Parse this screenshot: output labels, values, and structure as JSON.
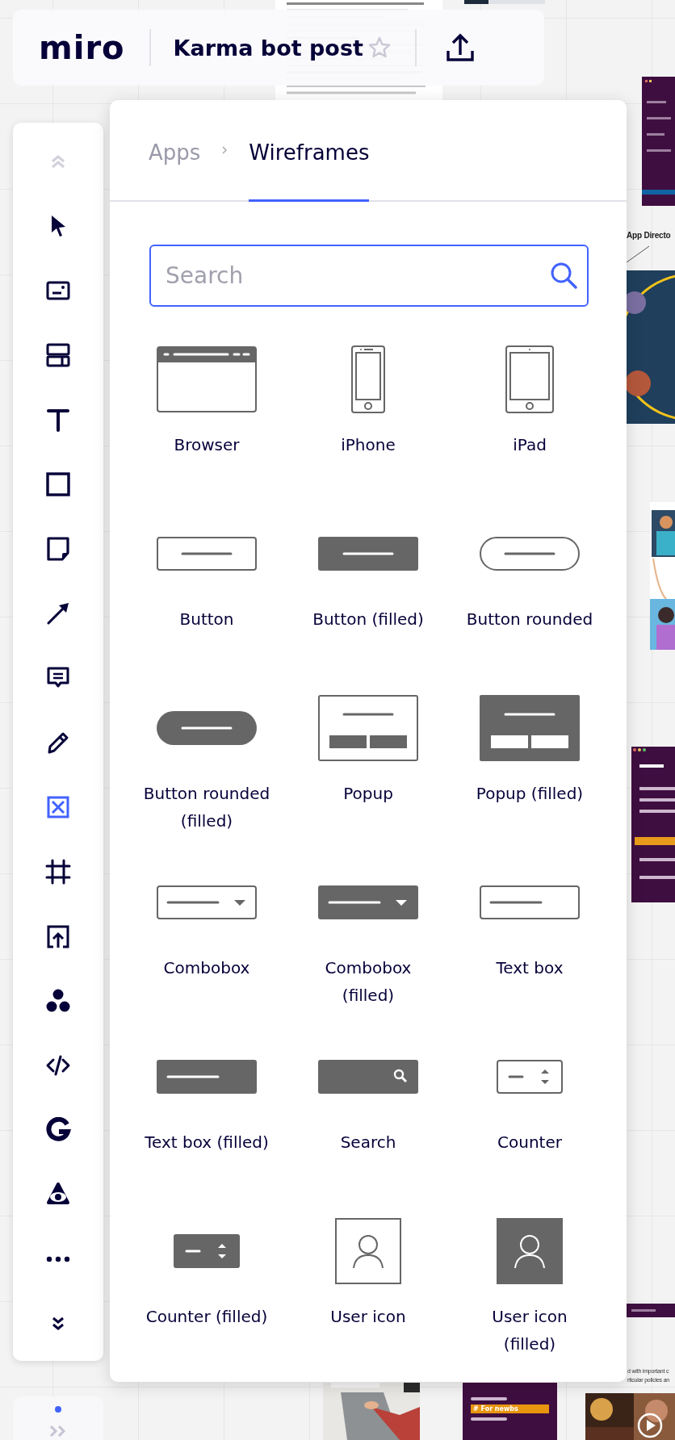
{
  "board": {
    "labels": [
      {
        "kind": "heading",
        "text": "App Directo"
      },
      {
        "kind": "note",
        "text": "d with important c"
      },
      {
        "kind": "note",
        "text": "rticular policies an"
      },
      {
        "kind": "channel",
        "text": "# For newbs"
      }
    ]
  },
  "top_bar": {
    "logo": "miro",
    "board_title": "Karma bot post",
    "starred": false
  },
  "toolbar": {
    "tools": [
      {
        "kind": "collapse-up",
        "selected": false,
        "disabled": true
      },
      {
        "kind": "select",
        "selected": false,
        "disabled": false
      },
      {
        "kind": "card",
        "selected": false,
        "disabled": false
      },
      {
        "kind": "templates",
        "selected": false,
        "disabled": false
      },
      {
        "kind": "text",
        "selected": false,
        "disabled": false
      },
      {
        "kind": "shape",
        "selected": false,
        "disabled": false
      },
      {
        "kind": "sticky",
        "selected": false,
        "disabled": false
      },
      {
        "kind": "arrow",
        "selected": false,
        "disabled": false
      },
      {
        "kind": "comment",
        "selected": false,
        "disabled": false
      },
      {
        "kind": "pen",
        "selected": false,
        "disabled": false
      },
      {
        "kind": "wireframe",
        "selected": true,
        "disabled": false
      },
      {
        "kind": "frame",
        "selected": false,
        "disabled": false
      },
      {
        "kind": "upload",
        "selected": false,
        "disabled": false
      },
      {
        "kind": "circles",
        "selected": false,
        "disabled": false
      },
      {
        "kind": "embed",
        "selected": false,
        "disabled": false
      },
      {
        "kind": "google",
        "selected": false,
        "disabled": false
      },
      {
        "kind": "eye",
        "selected": false,
        "disabled": false
      },
      {
        "kind": "more",
        "selected": false,
        "disabled": false
      },
      {
        "kind": "collapse-down",
        "selected": false,
        "disabled": false
      }
    ]
  },
  "panel": {
    "breadcrumb": [
      {
        "label": "Apps",
        "selected": false
      },
      {
        "label": "Wireframes",
        "selected": true
      }
    ],
    "search": {
      "placeholder": "Search"
    },
    "items": [
      {
        "kind": "browser",
        "label": "Browser"
      },
      {
        "kind": "iphone",
        "label": "iPhone"
      },
      {
        "kind": "ipad",
        "label": "iPad"
      },
      {
        "kind": "button",
        "label": "Button"
      },
      {
        "kind": "button-filled",
        "label": "Button (filled)"
      },
      {
        "kind": "button-rounded",
        "label": "Button rounded"
      },
      {
        "kind": "button-rounded-filled",
        "label": "Button rounded (filled)"
      },
      {
        "kind": "popup",
        "label": "Popup"
      },
      {
        "kind": "popup-filled",
        "label": "Popup (filled)"
      },
      {
        "kind": "combobox",
        "label": "Combobox"
      },
      {
        "kind": "combobox-filled",
        "label": "Combobox (filled)"
      },
      {
        "kind": "textbox",
        "label": "Text box"
      },
      {
        "kind": "textbox-filled",
        "label": "Text box (filled)"
      },
      {
        "kind": "search",
        "label": "Search"
      },
      {
        "kind": "counter",
        "label": "Counter"
      },
      {
        "kind": "counter-filled",
        "label": "Counter (filled)"
      },
      {
        "kind": "user",
        "label": "User icon"
      },
      {
        "kind": "user-filled",
        "label": "User icon (filled)"
      }
    ]
  },
  "minimap": {
    "indicator": true
  }
}
